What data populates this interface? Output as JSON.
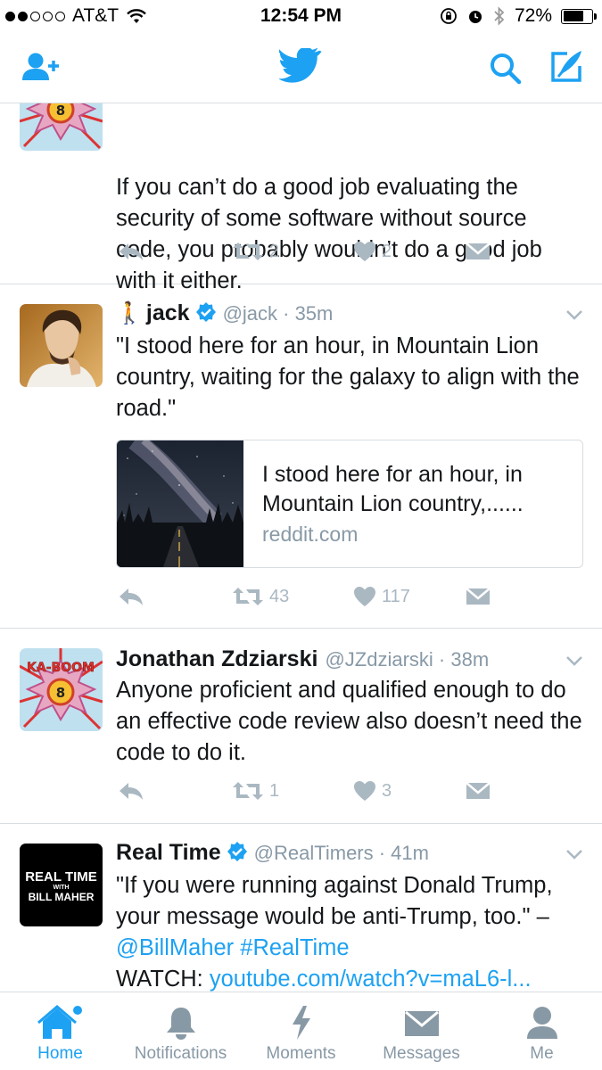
{
  "status_bar": {
    "carrier": "AT&T",
    "time": "12:54 PM",
    "battery": "72%",
    "battery_level": 0.72,
    "signal_dots_filled": 2,
    "signal_dots_total": 5
  },
  "nav": {
    "left_icon": "add-user-icon",
    "center_icon": "twitter-bird-icon",
    "right_icons": [
      "search-icon",
      "compose-tweet-icon"
    ],
    "accent_color": "#1DA1F2"
  },
  "tweets": [
    {
      "text": "If you can’t do a good job evaluating the security of some software without source code, you probably wouldn’t do a good job with it either.",
      "retweets": "2",
      "likes": "2"
    },
    {
      "emoji": "🚶",
      "name": "jack",
      "verified": true,
      "handle": "@jack · 35m",
      "text": "\"I stood here for an hour, in Mountain Lion country, waiting for the galaxy to align with the road.\"",
      "card": {
        "title": "I stood here for an hour, in Mountain Lion country,......",
        "domain": "reddit.com"
      },
      "retweets": "43",
      "likes": "117"
    },
    {
      "name": "Jonathan Zdziarski",
      "handle": "@JZdziarski · 38m",
      "text": "Anyone proficient and qualified enough to do an effective code review also doesn’t need the code to do it.",
      "retweets": "1",
      "likes": "3"
    },
    {
      "name": "Real Time",
      "verified": true,
      "handle": "@RealTimers · 41m",
      "text_part1": "\"If you were running against Donald Trump, your message would be anti-Trump, too.\" – ",
      "mention": "@BillMaher",
      "hashtag": "#RealTime",
      "watch_label": "WATCH: ",
      "url": "youtube.com/watch?v=maL6-l...",
      "avatar_text": {
        "line1": "REAL TIME",
        "line2": "WITH",
        "line3": "BILL MAHER"
      }
    }
  ],
  "avatar_art_text": "KA-BOOM",
  "tabs": [
    {
      "label": "Home",
      "icon": "home-icon",
      "active": true
    },
    {
      "label": "Notifications",
      "icon": "bell-icon",
      "active": false
    },
    {
      "label": "Moments",
      "icon": "lightning-icon",
      "active": false
    },
    {
      "label": "Messages",
      "icon": "envelope-icon",
      "active": false
    },
    {
      "label": "Me",
      "icon": "person-icon",
      "active": false
    }
  ]
}
